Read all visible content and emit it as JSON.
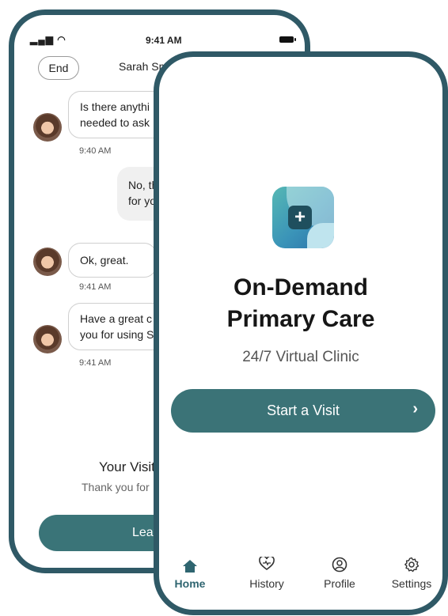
{
  "chat_screen": {
    "status": {
      "signal": "▂▄▆ ◠",
      "time": "9:41 AM"
    },
    "end_label": "End",
    "contact_name": "Sarah Smi",
    "messages": [
      {
        "from": "provider",
        "lines": [
          "Is there anythi",
          "needed to ask"
        ],
        "time": "9:40 AM"
      },
      {
        "from": "patient",
        "lines": [
          "No, th",
          "for yo"
        ]
      },
      {
        "from": "provider",
        "lines": [
          "Ok, great."
        ],
        "time": "9:41 AM"
      },
      {
        "from": "provider",
        "lines": [
          "Have a great c",
          "you for using S"
        ],
        "time": "9:41 AM"
      }
    ],
    "visit_title": "Your Visit",
    "visit_subtitle": "Thank you for",
    "leave_label": "Leav"
  },
  "home_screen": {
    "title_line1": "On-Demand",
    "title_line2": "Primary Care",
    "subtitle": "24/7 Virtual Clinic",
    "start_visit_label": "Start a Visit",
    "start_visit_chevron": "›",
    "tabs": [
      {
        "label": "Home",
        "icon": "home-icon",
        "active": true
      },
      {
        "label": "History",
        "icon": "heart-icon",
        "active": false
      },
      {
        "label": "Profile",
        "icon": "profile-icon",
        "active": false
      },
      {
        "label": "Settings",
        "icon": "gear-icon",
        "active": false
      }
    ]
  },
  "colors": {
    "frame": "#2f5966",
    "accent": "#3b7377",
    "tab_active": "#2f6570"
  }
}
